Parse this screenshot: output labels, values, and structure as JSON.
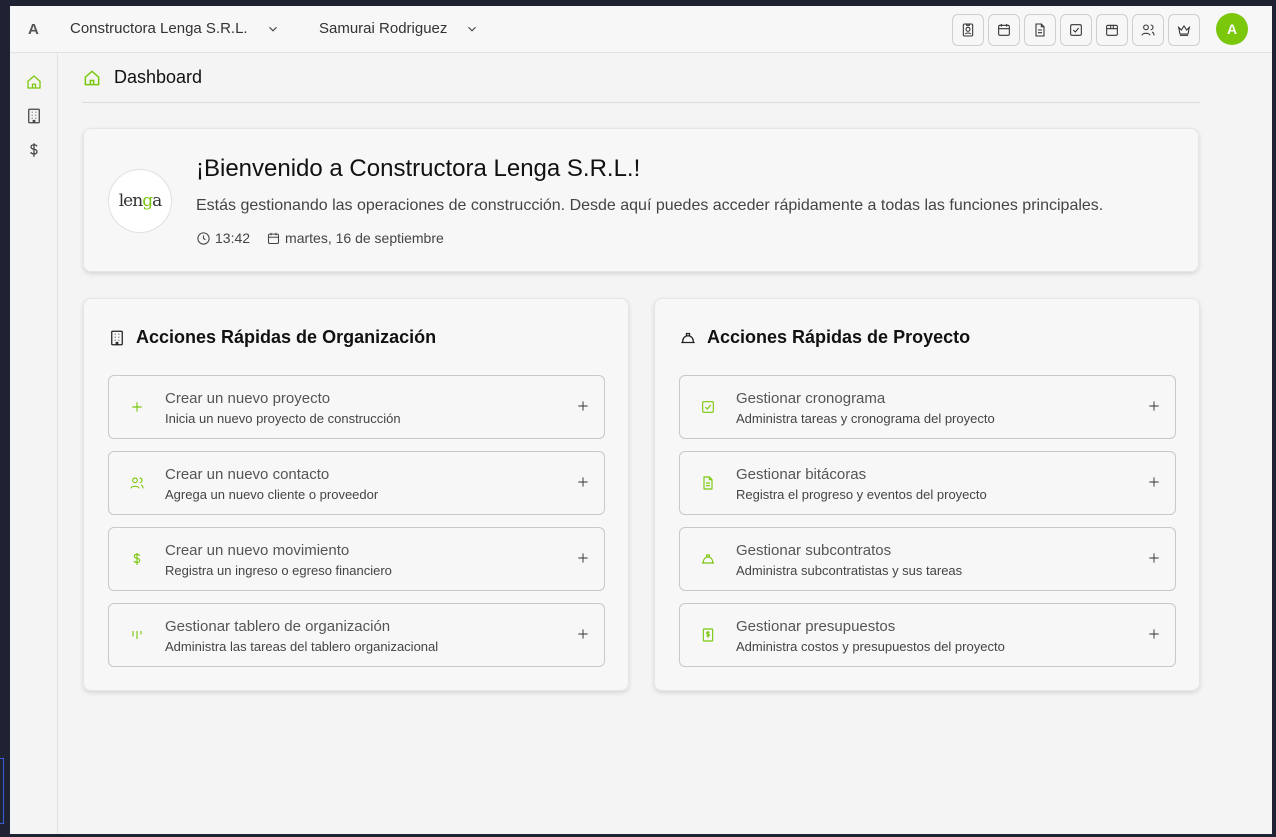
{
  "topbar": {
    "brand_letter": "A",
    "organization": "Constructora Lenga S.R.L.",
    "user": "Samurai Rodriguez",
    "tools": [
      "contact-card-icon",
      "calendar-icon",
      "document-icon",
      "checkbox-icon",
      "box-icon",
      "users-icon",
      "crown-icon"
    ],
    "avatar_initial": "A"
  },
  "sidebar": {
    "items": [
      "home-icon",
      "building-icon",
      "dollar-icon"
    ],
    "accent": "#7ac70c"
  },
  "page": {
    "title": "Dashboard"
  },
  "welcome": {
    "logo_text": "lenga",
    "title": "¡Bienvenido a Constructora Lenga S.R.L.!",
    "description": "Estás gestionando las operaciones de construcción. Desde aquí puedes acceder rápidamente a todas las funciones principales.",
    "time": "13:42",
    "date": "martes, 16 de septiembre"
  },
  "org_actions": {
    "title": "Acciones Rápidas de Organización",
    "items": [
      {
        "title": "Crear un nuevo proyecto",
        "subtitle": "Inicia un nuevo proyecto de construcción",
        "icon": "plus-icon"
      },
      {
        "title": "Crear un nuevo contacto",
        "subtitle": "Agrega un nuevo cliente o proveedor",
        "icon": "users-icon"
      },
      {
        "title": "Crear un nuevo movimiento",
        "subtitle": "Registra un ingreso o egreso financiero",
        "icon": "dollar-icon"
      },
      {
        "title": "Gestionar tablero de organización",
        "subtitle": "Administra las tareas del tablero organizacional",
        "icon": "kanban-icon"
      }
    ]
  },
  "project_actions": {
    "title": "Acciones Rápidas de Proyecto",
    "items": [
      {
        "title": "Gestionar cronograma",
        "subtitle": "Administra tareas y cronograma del proyecto",
        "icon": "checkbox-icon"
      },
      {
        "title": "Gestionar bitácoras",
        "subtitle": "Registra el progreso y eventos del proyecto",
        "icon": "document-icon"
      },
      {
        "title": "Gestionar subcontratos",
        "subtitle": "Administra subcontratistas y sus tareas",
        "icon": "hardhat-icon"
      },
      {
        "title": "Gestionar presupuestos",
        "subtitle": "Administra costos y presupuestos del proyecto",
        "icon": "receipt-icon"
      }
    ]
  }
}
